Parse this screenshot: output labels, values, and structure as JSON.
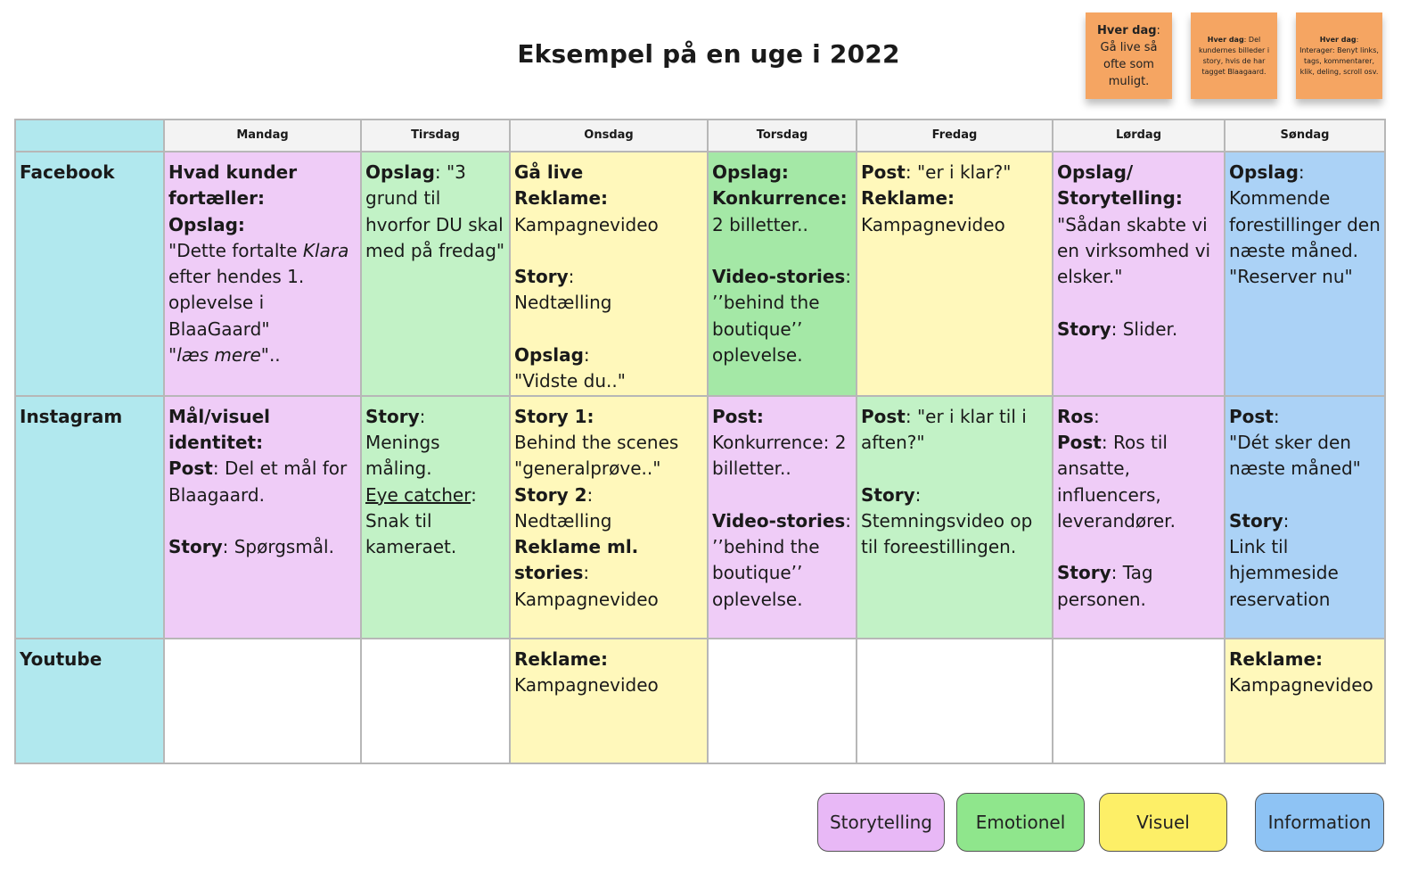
{
  "title": "Eksempel på en uge i 2022",
  "sticky_notes": [
    {
      "heading": "Hver dag",
      "colon": ":",
      "text": "Gå live så ofte som muligt.",
      "color": "#f5a562"
    },
    {
      "heading": "Hver dag",
      "colon": ":",
      "text": "Del kundernes billeder i  story, hvis de har tagget Blaagaard.",
      "color": "#f5a562"
    },
    {
      "heading": "Hver dag",
      "colon": ":",
      "text": "Interager: Benyt links, tags, kommentarer, klik, deling, scroll osv.",
      "color": "#f5a562"
    }
  ],
  "days": [
    "Mandag",
    "Tirsdag",
    "Onsdag",
    "Torsdag",
    "Fredag",
    "Lørdag",
    "Søndag"
  ],
  "channels": [
    "Facebook",
    "Instagram",
    "Youtube"
  ],
  "cells": {
    "fb_man": {
      "h1": "Hvad kunder fortæller:",
      "h2": "Opslag:",
      "t1": "\"Dette fortalte ",
      "t1i": "Klara",
      "t2": " efter hendes 1. oplevelse i BlaaGaard\"",
      "t3": "\"læs mere\"",
      "t4": ".."
    },
    "fb_tir": {
      "h1": "Opslag",
      "t1": ": \"3 grund til hvorfor DU skal med på fredag\""
    },
    "fb_ons": {
      "h1": "Gå live",
      "h2": "Reklame:",
      "t2": "Kampagnevideo",
      "h3": "Story",
      "t3": ":",
      "t3b": "Nedtælling",
      "h4": "Opslag",
      "t4": ":",
      "t4b": "\"Vidste du..\""
    },
    "fb_tor": {
      "h1": "Opslag:",
      "h2": "Konkurrence:",
      "t2": "2 billetter..",
      "h3": "Video-stories",
      "t3": ":",
      "t3b": "’’behind the boutique’’ oplevelse."
    },
    "fb_fre": {
      "h1": "Post",
      "t1": ": \"er i klar?\"",
      "h2": "Reklame:",
      "t2": "Kampagnevideo"
    },
    "fb_lor": {
      "h1": "Opslag/ Storytelling:",
      "t1": "\"Sådan skabte vi en virksomhed vi elsker.\"",
      "h2": "Story",
      "t2": ": Slider."
    },
    "fb_son": {
      "h1": "Opslag",
      "t1": ":",
      "t1b": "Kommende forestillinger den næste måned. \"Reserver nu\""
    },
    "ig_man": {
      "h1": "Mål/visuel identitet:",
      "h2": "Post",
      "t2": ": Del et mål for Blaagaard.",
      "h3": "Story",
      "t3": ": Spørgsmål."
    },
    "ig_tir": {
      "h1": "Story",
      "t1": ": Menings måling.",
      "u1": "Eye catcher",
      "t2": ": Snak til kameraet."
    },
    "ig_ons": {
      "h1": "Story 1:",
      "t1": "Behind the scenes \"generalprøve..\"",
      "h2": "Story 2",
      "t2": ":",
      "t2b": "Nedtælling",
      "h3": "Reklame ml. stories",
      "t3": ":",
      "t3b": "Kampagnevideo"
    },
    "ig_tor": {
      "h1": "Post:",
      "t1": "Konkurrence: 2 billetter..",
      "h2": "Video-stories",
      "t2": ":",
      "t2b": "’’behind the boutique’’ oplevelse."
    },
    "ig_fre": {
      "h1": "Post",
      "t1": ": \"er i klar til i aften?\"",
      "h2": "Story",
      "t2": ":",
      "t2b": "Stemningsvideo op til foreestillingen."
    },
    "ig_lor": {
      "h1": "Ros",
      "t1": ":",
      "h2": "Post",
      "t2": ": Ros til ansatte, influencers, leverandører.",
      "h3": "Story",
      "t3": ": Tag personen."
    },
    "ig_son": {
      "h1": "Post",
      "t1": ":",
      "t1b": "\"Dét sker den næste måned\"",
      "h2": "Story",
      "t2": ":",
      "t2b": "Link til hjemmeside reservation"
    },
    "yt_ons": {
      "h1": "Reklame:",
      "t1": "Kampagnevideo"
    },
    "yt_son": {
      "h1": "Reklame:",
      "t1": "Kampagnevideo"
    }
  },
  "legend": [
    {
      "label": "Storytelling",
      "color": "#e8b8f6"
    },
    {
      "label": "Emotionel",
      "color": "#8fe68c"
    },
    {
      "label": "Visuel",
      "color": "#fdef67"
    },
    {
      "label": "Information",
      "color": "#8ec3f4"
    }
  ],
  "cell_colors": {
    "storytelling": "#efccf7",
    "emotionel": "#c2f2c6",
    "visuel": "#fff8bb",
    "information": "#abd2f6",
    "channel": "#b1e8ee"
  }
}
